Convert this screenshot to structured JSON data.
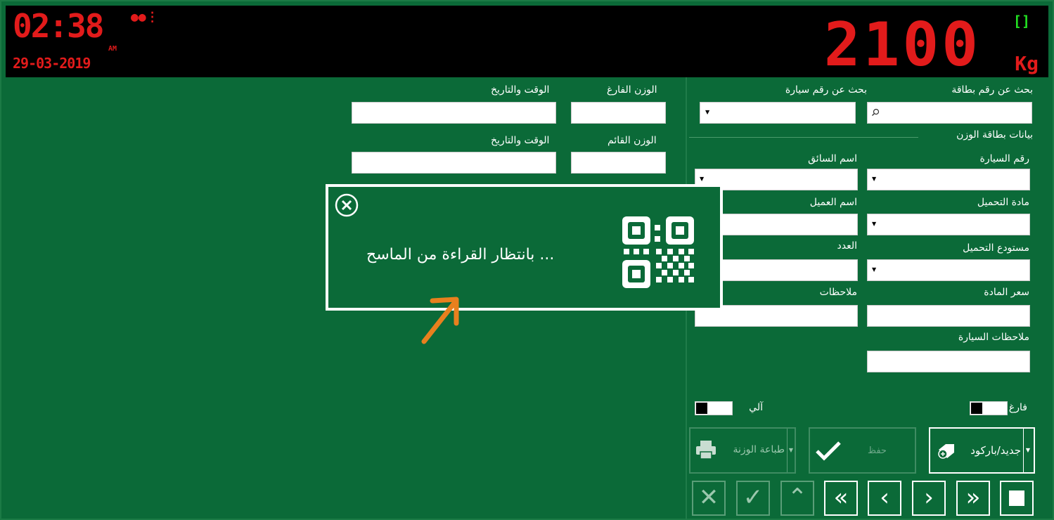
{
  "display": {
    "clock": "02:38",
    "ampm": "AM",
    "date": "29-03-2019",
    "weight": "2100",
    "unit": "Kg",
    "stable_indicator": "[]"
  },
  "search": {
    "card_label": "بحث عن رقم بطاقة",
    "car_label": "بحث عن رقم سيارة"
  },
  "weights": {
    "empty_weight_label": "الوزن الفارغ",
    "empty_datetime_label": "الوقت والتاريخ",
    "full_weight_label": "الوزن القائم",
    "full_datetime_label": "الوقت والتاريخ"
  },
  "card_section": {
    "title": "بيانات بطاقة الوزن",
    "car_number": "رقم السيارة",
    "driver_name": "اسم السائق",
    "material": "مادة التحميل",
    "customer_name": "اسم العميل",
    "warehouse": "مستودع التحميل",
    "count": "العدد",
    "material_price": "سعر المادة",
    "notes": "ملاحظات",
    "car_notes": "ملاحظات السيارة"
  },
  "toggles": {
    "empty": "فارغ",
    "auto": "آلي"
  },
  "buttons": {
    "new_barcode": "جديد/باركود",
    "save": "حفظ",
    "print": "طباعة الوزنة"
  },
  "popup": {
    "message": "بانتظار القراءة من الماسح ..."
  },
  "icons": {
    "close": "close-icon",
    "qr": "qr-icon",
    "search": "search-icon",
    "printer": "printer-icon",
    "check": "check-icon",
    "barcode_tag": "tag-add-icon"
  },
  "colors": {
    "background": "#0b6a38",
    "display_red": "#e21b1b",
    "stable_green": "#22e022",
    "arrow": "#e8801e"
  }
}
